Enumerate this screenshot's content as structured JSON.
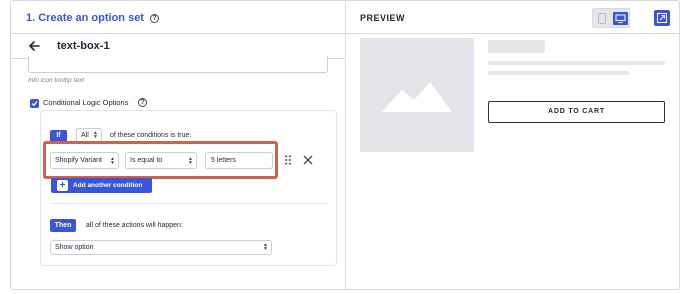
{
  "left_panel": {
    "title": "1. Create an option set",
    "sub_title": "text-box-1",
    "tooltip_help_text": "Info icon tooltip text",
    "conditional_logic_label": "Conditional Logic Options",
    "if_label": "If",
    "match_select_value": "All",
    "conditions_text": "of these conditions is true:",
    "condition": {
      "field": "Shopify Variant",
      "operator": "Is equal to",
      "value": "5 letters"
    },
    "add_condition_label": "Add another condition",
    "then_label": "Then",
    "actions_text": "all of these actions will happen:",
    "action_select_value": "Show option"
  },
  "right_panel": {
    "preview_label": "PREVIEW",
    "add_to_cart_label": "ADD TO CART"
  },
  "colors": {
    "accent": "#3b55d9",
    "highlight": "#c86452"
  }
}
